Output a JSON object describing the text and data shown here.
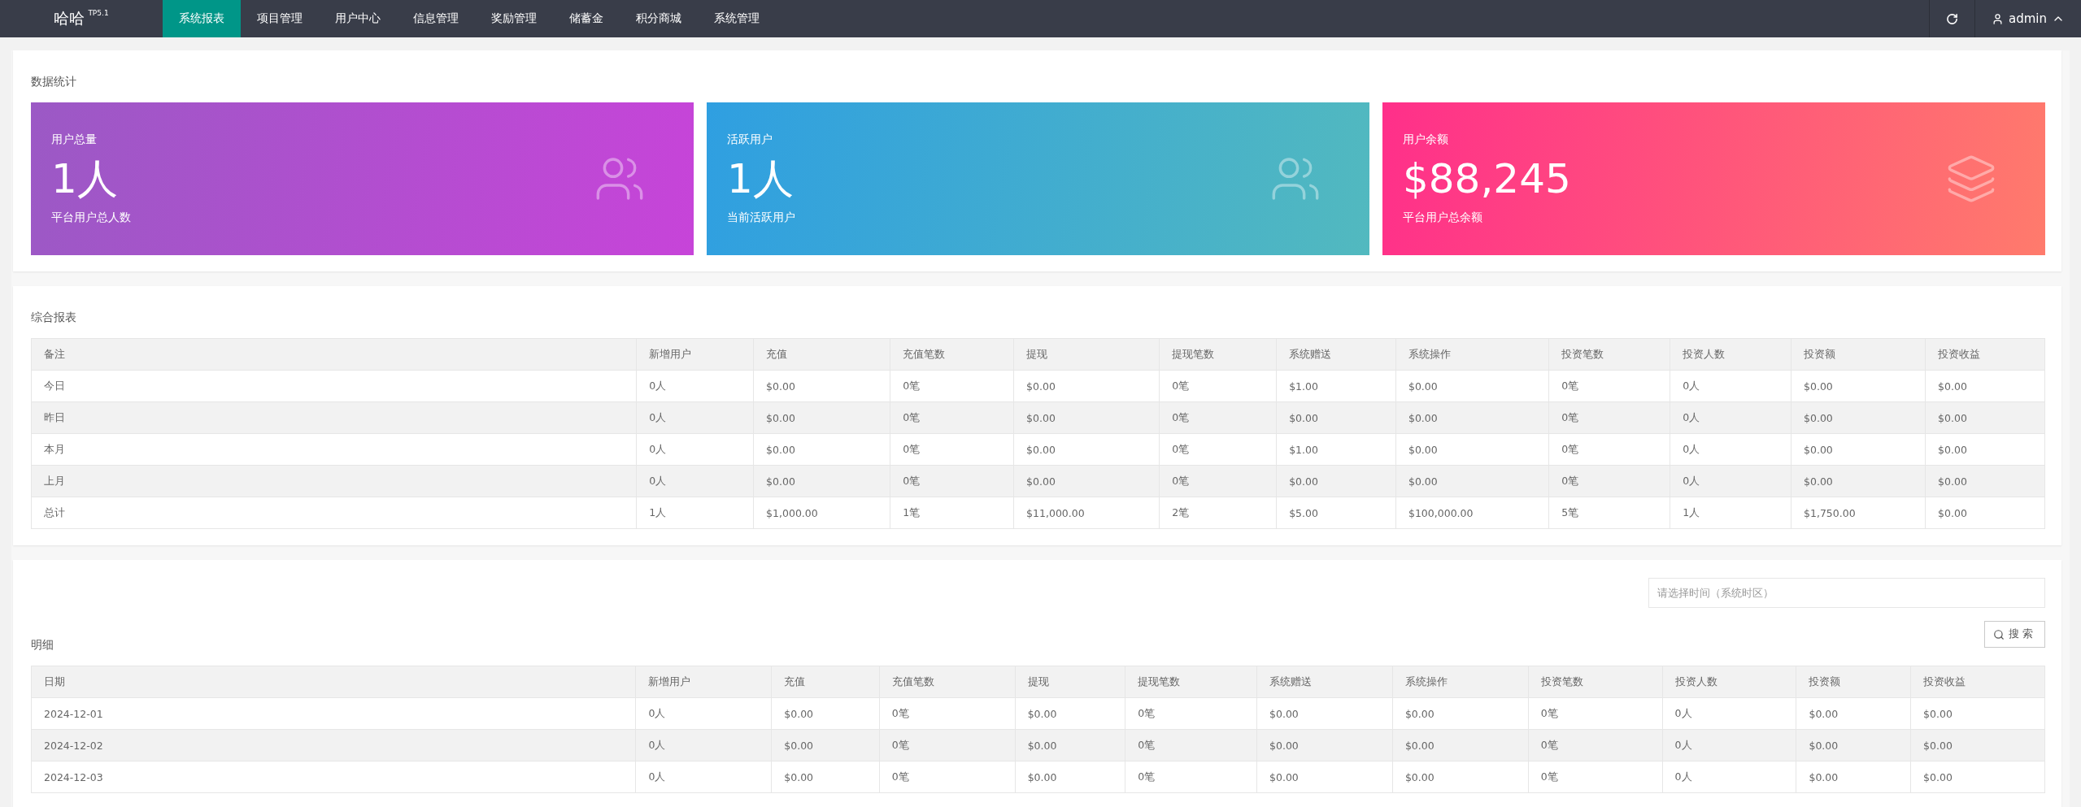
{
  "navbar": {
    "logo": "哈哈",
    "version": "TP5.1",
    "menu": [
      {
        "label": "系统报表",
        "selected": true
      },
      {
        "label": "项目管理",
        "selected": false
      },
      {
        "label": "用户中心",
        "selected": false
      },
      {
        "label": "信息管理",
        "selected": false
      },
      {
        "label": "奖励管理",
        "selected": false
      },
      {
        "label": "储蓄金",
        "selected": false
      },
      {
        "label": "积分商城",
        "selected": false
      },
      {
        "label": "系统管理",
        "selected": false
      }
    ],
    "user": "admin"
  },
  "stats": {
    "title": "数据统计",
    "cards": [
      {
        "kind": "users",
        "label": "用户总量",
        "value": "1人",
        "caption": "平台用户总人数"
      },
      {
        "kind": "users",
        "label": "活跃用户",
        "value": "1人",
        "caption": "当前活跃用户"
      },
      {
        "kind": "layers",
        "label": "用户余额",
        "value": "$88,245",
        "caption": "平台用户总余额"
      }
    ]
  },
  "summary": {
    "title": "综合报表",
    "columns": [
      "备注",
      "新增用户",
      "充值",
      "充值笔数",
      "提现",
      "提现笔数",
      "系统赠送",
      "系统操作",
      "投资笔数",
      "投资人数",
      "投资额",
      "投资收益"
    ],
    "rows": [
      [
        "今日",
        "0人",
        "$0.00",
        "0笔",
        "$0.00",
        "0笔",
        "$1.00",
        "$0.00",
        "0笔",
        "0人",
        "$0.00",
        "$0.00"
      ],
      [
        "昨日",
        "0人",
        "$0.00",
        "0笔",
        "$0.00",
        "0笔",
        "$0.00",
        "$0.00",
        "0笔",
        "0人",
        "$0.00",
        "$0.00"
      ],
      [
        "本月",
        "0人",
        "$0.00",
        "0笔",
        "$0.00",
        "0笔",
        "$1.00",
        "$0.00",
        "0笔",
        "0人",
        "$0.00",
        "$0.00"
      ],
      [
        "上月",
        "0人",
        "$0.00",
        "0笔",
        "$0.00",
        "0笔",
        "$0.00",
        "$0.00",
        "0笔",
        "0人",
        "$0.00",
        "$0.00"
      ],
      [
        "总计",
        "1人",
        "$1,000.00",
        "1笔",
        "$11,000.00",
        "2笔",
        "$5.00",
        "$100,000.00",
        "5笔",
        "1人",
        "$1,750.00",
        "$0.00"
      ]
    ]
  },
  "detail": {
    "date_field": {
      "placeholder": "请选择时间（系统时区）"
    },
    "search_button": "搜索",
    "title": "明细",
    "columns": [
      "日期",
      "新增用户",
      "充值",
      "充值笔数",
      "提现",
      "提现笔数",
      "系统赠送",
      "系统操作",
      "投资笔数",
      "投资人数",
      "投资额",
      "投资收益"
    ],
    "rows": [
      [
        "2024-12-01",
        "0人",
        "$0.00",
        "0笔",
        "$0.00",
        "0笔",
        "$0.00",
        "$0.00",
        "0笔",
        "0人",
        "$0.00",
        "$0.00"
      ],
      [
        "2024-12-02",
        "0人",
        "$0.00",
        "0笔",
        "$0.00",
        "0笔",
        "$0.00",
        "$0.00",
        "0笔",
        "0人",
        "$0.00",
        "$0.00"
      ],
      [
        "2024-12-03",
        "0人",
        "$0.00",
        "0笔",
        "$0.00",
        "0笔",
        "$0.00",
        "$0.00",
        "0笔",
        "0人",
        "$0.00",
        "$0.00"
      ]
    ]
  }
}
